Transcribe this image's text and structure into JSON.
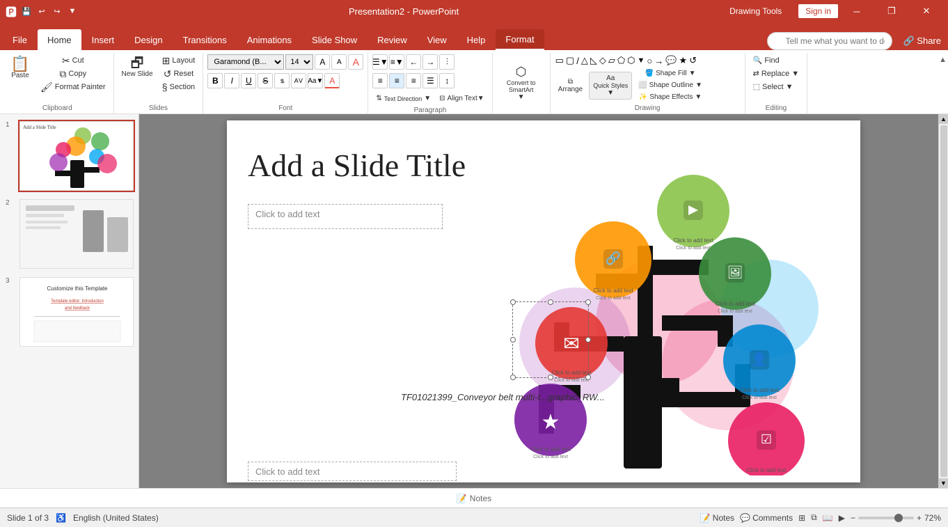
{
  "titlebar": {
    "save_icon": "💾",
    "undo_icon": "↩",
    "redo_icon": "↪",
    "customize_icon": "▼",
    "title": "Presentation2 - PowerPoint",
    "drawing_tools": "Drawing Tools",
    "sign_in": "Sign in",
    "minimize": "─",
    "restore": "❐",
    "close": "✕"
  },
  "tabs": [
    {
      "label": "File",
      "id": "file"
    },
    {
      "label": "Home",
      "id": "home",
      "active": true
    },
    {
      "label": "Insert",
      "id": "insert"
    },
    {
      "label": "Design",
      "id": "design"
    },
    {
      "label": "Transitions",
      "id": "transitions"
    },
    {
      "label": "Animations",
      "id": "animations"
    },
    {
      "label": "Slide Show",
      "id": "slideshow"
    },
    {
      "label": "Review",
      "id": "review"
    },
    {
      "label": "View",
      "id": "view"
    },
    {
      "label": "Help",
      "id": "help"
    },
    {
      "label": "Format",
      "id": "format",
      "drawing_tools": true
    }
  ],
  "ribbon": {
    "clipboard": {
      "label": "Clipboard",
      "paste_label": "Paste",
      "cut_label": "Cut",
      "copy_label": "Copy",
      "format_painter_label": "Format Painter"
    },
    "slides": {
      "label": "Slides",
      "new_slide_label": "New Slide",
      "layout_label": "Layout",
      "reset_label": "Reset",
      "section_label": "Section"
    },
    "font": {
      "label": "Font",
      "font_name": "Garamond (B...",
      "font_size": "14",
      "grow_label": "A",
      "shrink_label": "A",
      "clear_label": "A",
      "bold_label": "B",
      "italic_label": "I",
      "underline_label": "U",
      "strikethrough_label": "S",
      "shadow_label": "s",
      "char_spacing_label": "AV",
      "change_case_label": "Aa",
      "font_color_label": "A"
    },
    "paragraph": {
      "label": "Paragraph",
      "bullets_label": "≡",
      "numbering_label": "≡",
      "decrease_indent_label": "←",
      "increase_indent_label": "→",
      "text_direction_label": "Text Direction",
      "align_text_label": "Align Text",
      "convert_smartart_label": "Convert to SmartArt",
      "align_left": "≡",
      "align_center": "≡",
      "align_right": "≡",
      "justify": "≡",
      "line_spacing": "≡"
    },
    "drawing": {
      "label": "Drawing",
      "arrange_label": "Arrange",
      "quick_styles_label": "Quick Styles",
      "shape_fill_label": "Shape Fill",
      "shape_outline_label": "Shape Outline",
      "shape_effects_label": "Shape Effects"
    },
    "editing": {
      "label": "Editing",
      "find_label": "Find",
      "replace_label": "Replace",
      "select_label": "Select"
    }
  },
  "tell_me": {
    "placeholder": "Tell me what you want to do"
  },
  "slides": [
    {
      "number": "1",
      "active": true,
      "title": "Add a Slide Title"
    },
    {
      "number": "2",
      "active": false
    },
    {
      "number": "3",
      "active": false
    }
  ],
  "slide": {
    "title": "Add a Slide Title",
    "text_placeholder_top": "Click to add text",
    "text_placeholder_bottom": "Click to add text",
    "filename": "TF01021399_Conveyor belt multi-t...graphic_RW..."
  },
  "status_bar": {
    "slide_info": "Slide 1 of 3",
    "language": "English (United States)",
    "notes_label": "Notes",
    "comments_label": "Comments",
    "zoom": "72%"
  }
}
